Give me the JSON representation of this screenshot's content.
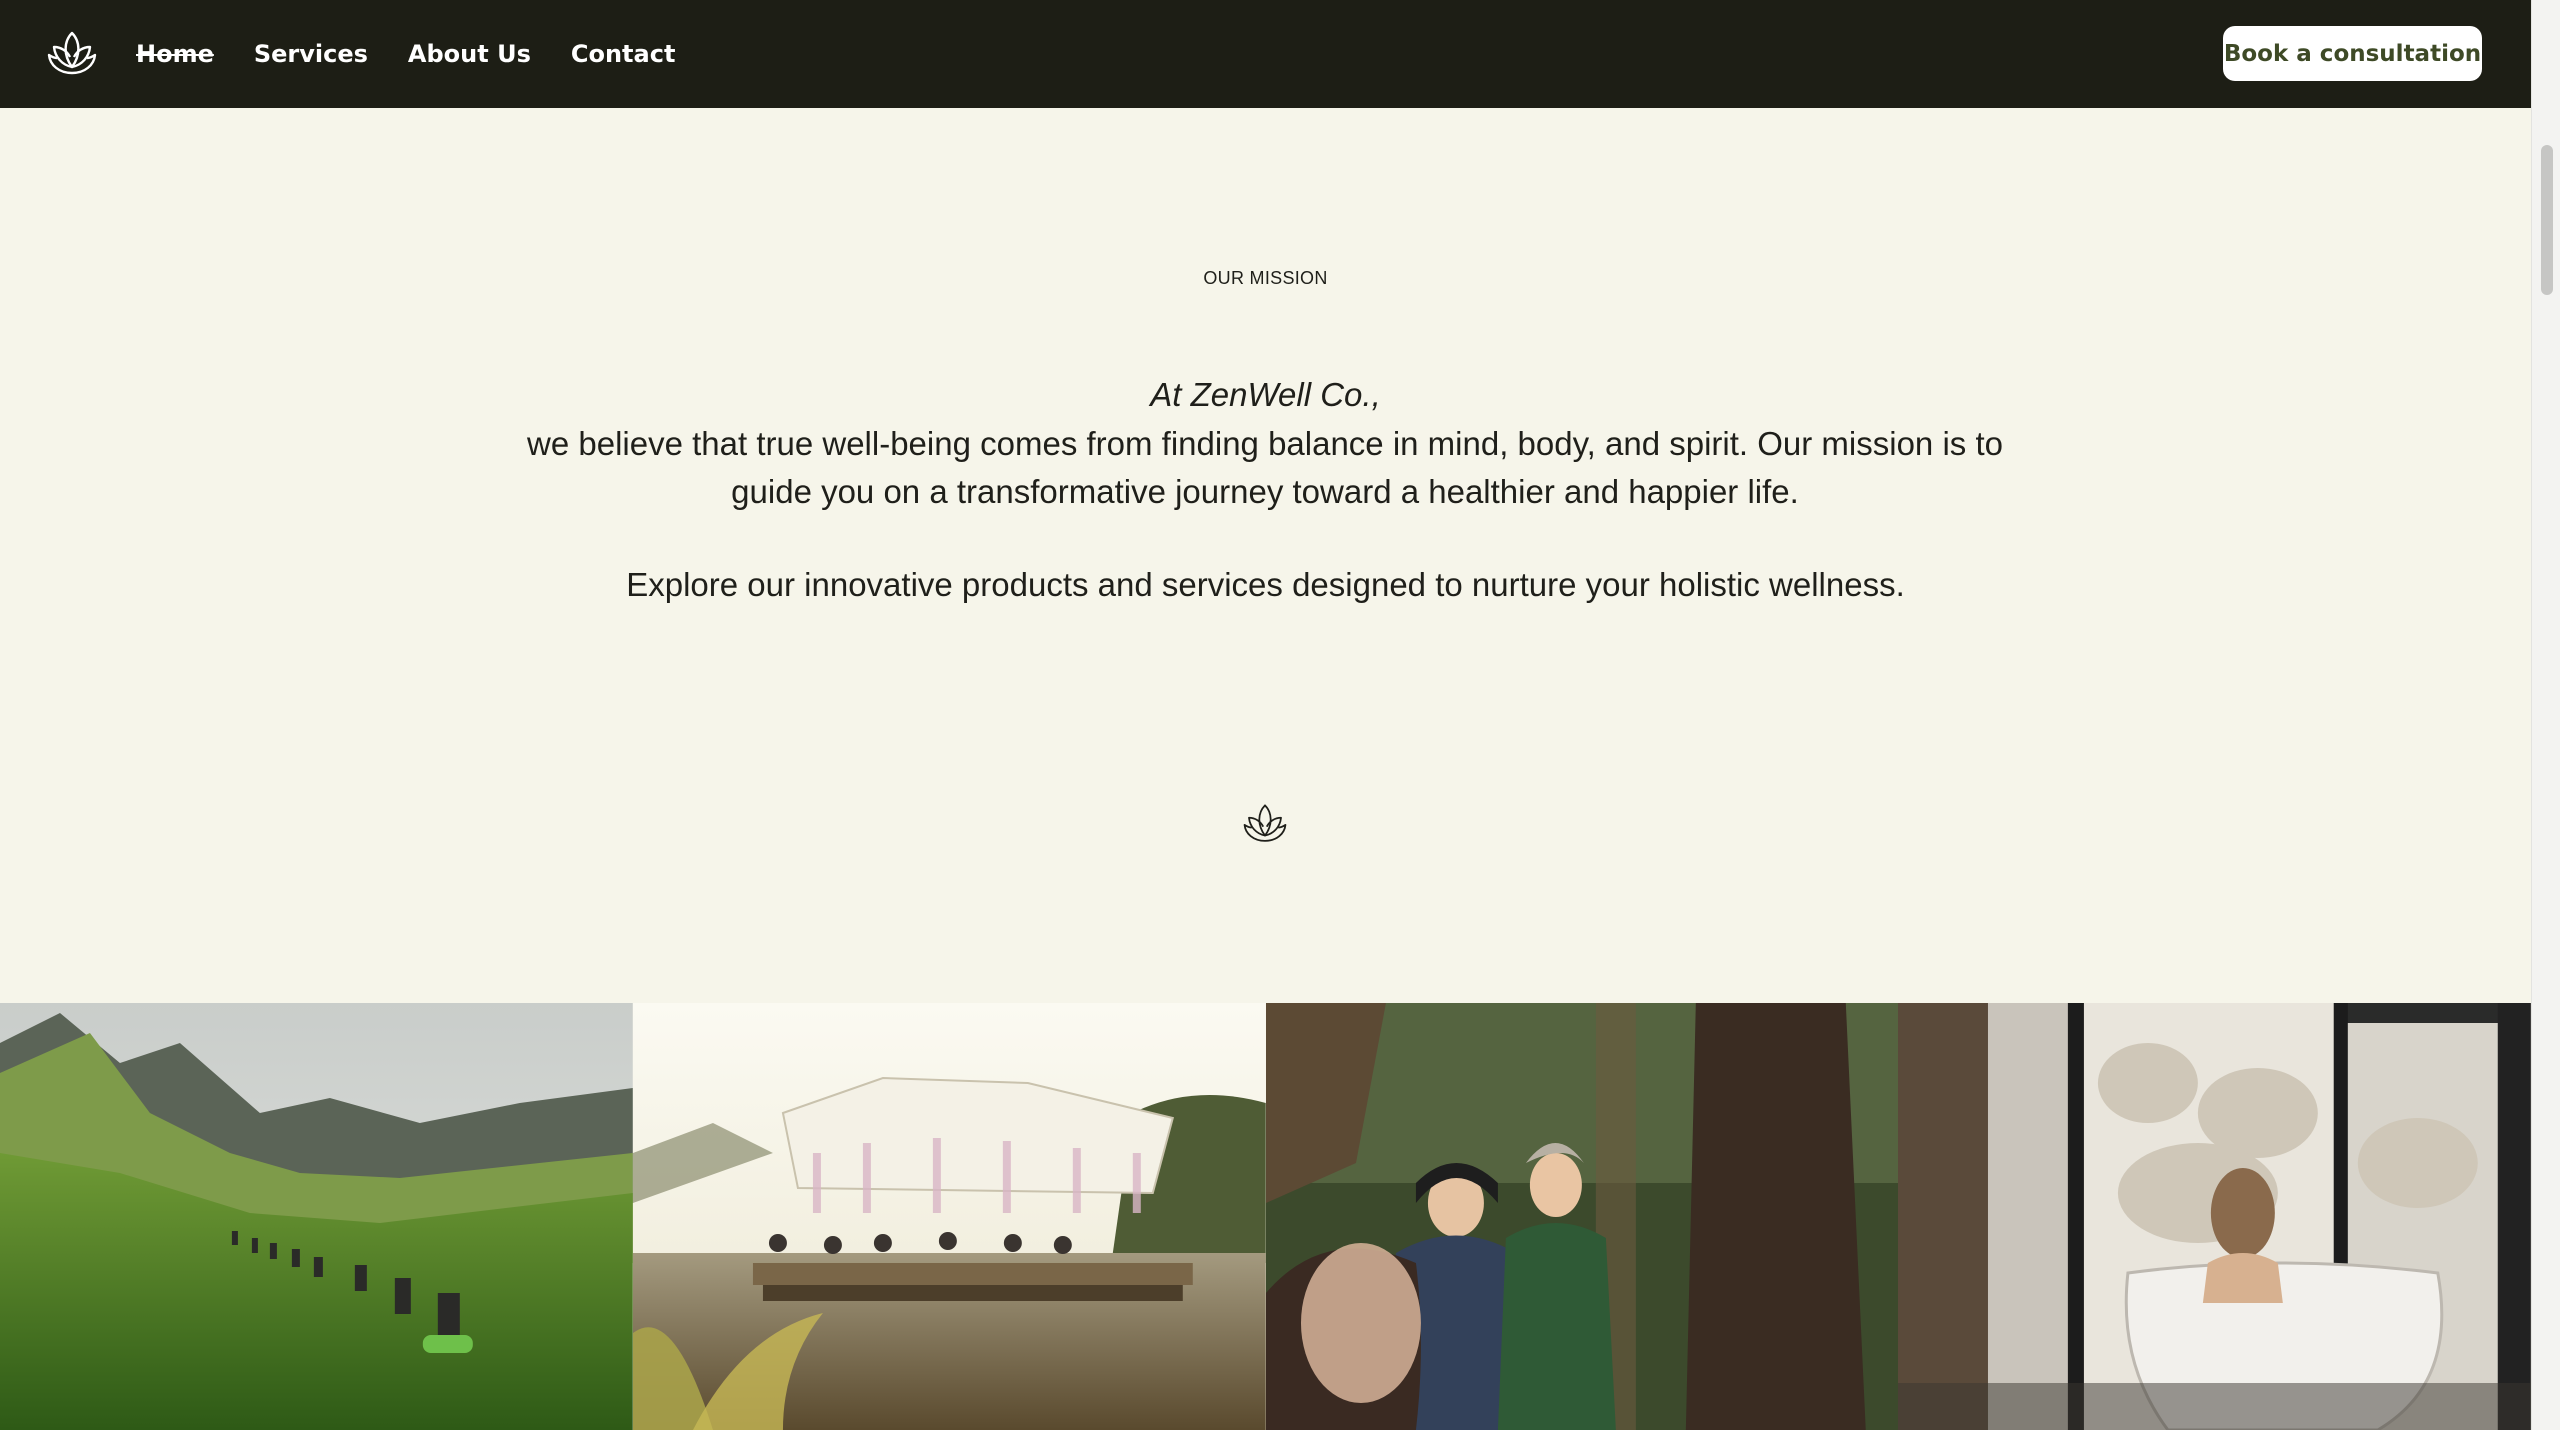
{
  "header": {
    "logo_icon": "lotus-icon",
    "nav": [
      {
        "label": "Home"
      },
      {
        "label": "Services"
      },
      {
        "label": "About Us"
      },
      {
        "label": "Contact"
      }
    ],
    "cta_label": "Book a consultation"
  },
  "mission": {
    "eyebrow": "OUR MISSION",
    "lead": "At ZenWell Co.,",
    "body": "we believe that true well-being comes from finding balance in mind, body, and spirit. Our mission is to guide you on a transformative journey toward a healthier and happier life.",
    "explore": "Explore our innovative products and services designed to nurture your holistic wellness.",
    "divider_icon": "lotus-icon"
  },
  "gallery": [
    {
      "subject": "hikers-meadow-photo"
    },
    {
      "subject": "lake-yoga-pavilion-photo"
    },
    {
      "subject": "forest-friends-photo"
    },
    {
      "subject": "bath-window-photo"
    }
  ],
  "colors": {
    "header_bg": "#1d1e15",
    "page_bg": "#f6f5ea",
    "cta_text": "#3e4a26"
  }
}
